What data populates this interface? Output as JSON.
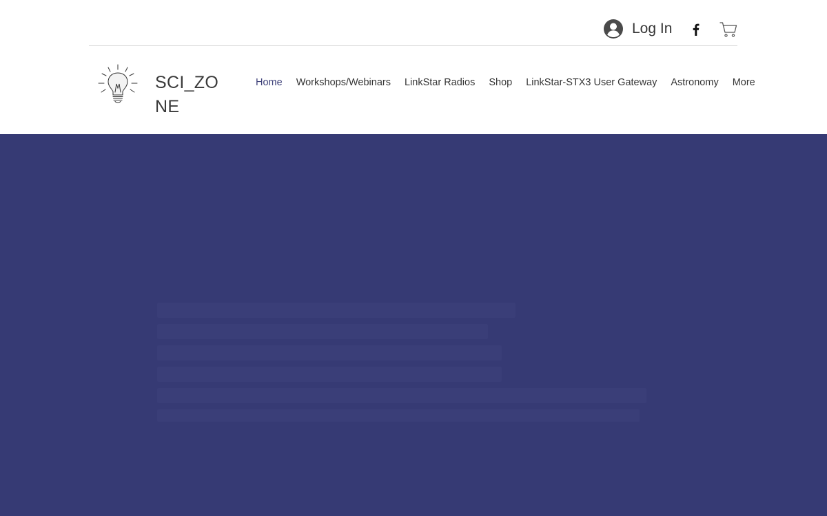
{
  "header": {
    "login_label": "Log In",
    "brand": "SCI_ZONE",
    "icons": {
      "avatar": "user-avatar-icon",
      "facebook": "facebook-icon",
      "cart": "shopping-cart-icon",
      "logo": "lightbulb-logo-icon"
    }
  },
  "nav": {
    "items": [
      {
        "label": "Home",
        "active": true
      },
      {
        "label": "Workshops/Webinars",
        "active": false
      },
      {
        "label": "LinkStar Radios",
        "active": false
      },
      {
        "label": "Shop",
        "active": false
      },
      {
        "label": "LinkStar-STX3 User Gateway",
        "active": false
      },
      {
        "label": "Astronomy",
        "active": false
      },
      {
        "label": "More",
        "active": false
      }
    ]
  },
  "colors": {
    "hero_background": "#363a74",
    "nav_active": "#3c3f78",
    "text": "#353535"
  }
}
